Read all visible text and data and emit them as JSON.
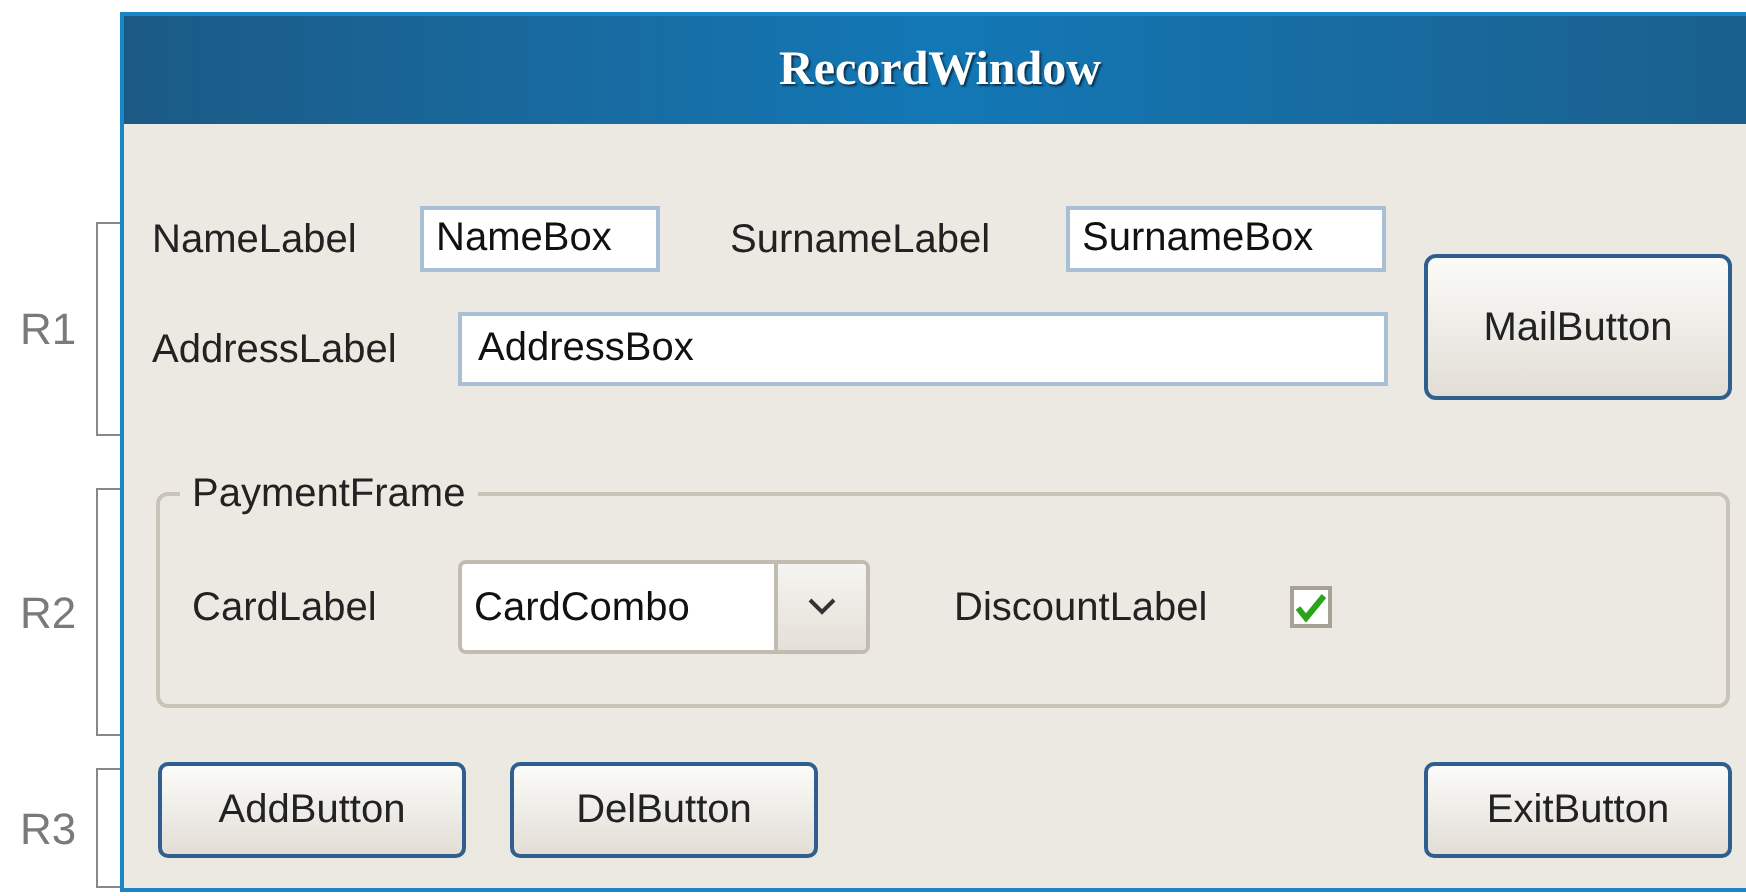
{
  "annotations": [
    {
      "label": "R1"
    },
    {
      "label": "R2"
    },
    {
      "label": "R3"
    }
  ],
  "window": {
    "title": "RecordWindow"
  },
  "name": {
    "label": "NameLabel",
    "value": "NameBox"
  },
  "surname": {
    "label": "SurnameLabel",
    "value": "SurnameBox"
  },
  "address": {
    "label": "AddressLabel",
    "value": "AddressBox"
  },
  "mail_button": "MailButton",
  "payment_frame": {
    "title": "PaymentFrame",
    "card": {
      "label": "CardLabel",
      "value": "CardCombo"
    },
    "discount": {
      "label": "DiscountLabel",
      "checked": true
    }
  },
  "buttons": [
    "AddButton",
    "DelButton",
    "ExitButton"
  ]
}
